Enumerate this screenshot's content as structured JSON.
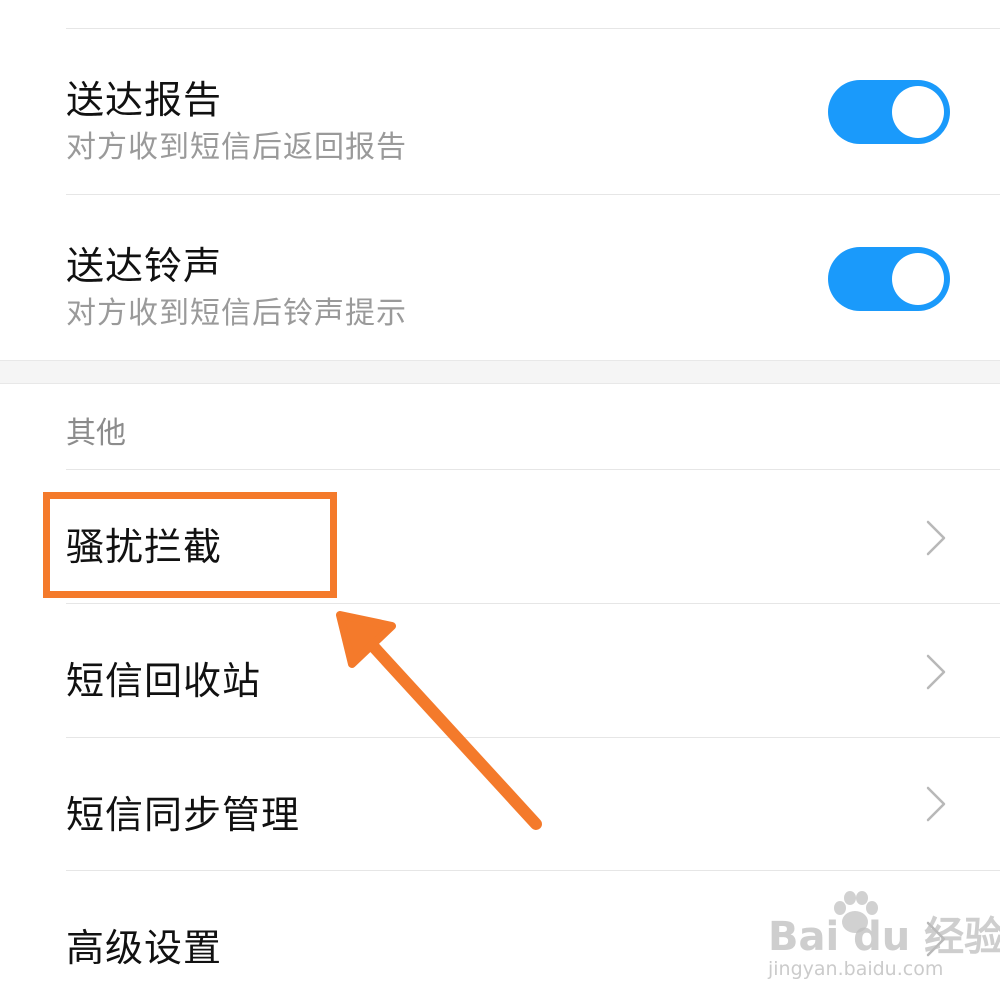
{
  "settings": {
    "delivery_report": {
      "title": "送达报告",
      "subtitle": "对方收到短信后返回报告",
      "enabled": true
    },
    "delivery_ringtone": {
      "title": "送达铃声",
      "subtitle": "对方收到短信后铃声提示",
      "enabled": true
    }
  },
  "other_section": {
    "header": "其他",
    "items": [
      {
        "label": "骚扰拦截",
        "icon": "chevron-right-icon"
      },
      {
        "label": "短信回收站",
        "icon": "chevron-right-icon"
      },
      {
        "label": "短信同步管理",
        "icon": "chevron-right-icon"
      },
      {
        "label": "高级设置",
        "icon": "chevron-right-icon"
      }
    ]
  },
  "annotation": {
    "color": "#f47a2b",
    "highlighted_item": "骚扰拦截"
  },
  "watermark": {
    "logo_text": "Bai du 经验",
    "url": "jingyan.baidu.com"
  },
  "colors": {
    "toggle_on": "#1a9afb",
    "divider": "#e6e6e6",
    "subtitle": "#9a9a9a"
  }
}
